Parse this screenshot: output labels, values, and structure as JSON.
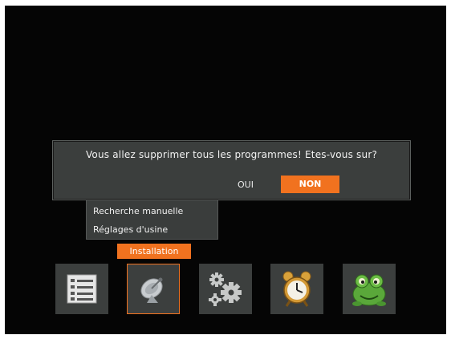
{
  "dialog": {
    "message": "Vous allez supprimer tous les programmes! Etes-vous sur?",
    "buttons": {
      "yes": "OUI",
      "no": "NON"
    },
    "selected": "no"
  },
  "submenu": {
    "items": [
      {
        "label": "Recherche manuelle"
      },
      {
        "label": "Réglages d'usine"
      }
    ]
  },
  "menu_bar": {
    "selected_label": "Installation",
    "tiles": [
      {
        "icon": "channel-list-icon"
      },
      {
        "icon": "satellite-dish-icon",
        "selected": true
      },
      {
        "icon": "gears-icon"
      },
      {
        "icon": "alarm-clock-icon"
      },
      {
        "icon": "game-frog-icon"
      }
    ]
  },
  "colors": {
    "accent": "#f1721f",
    "panel": "#3b3e3d",
    "background": "#050505"
  }
}
